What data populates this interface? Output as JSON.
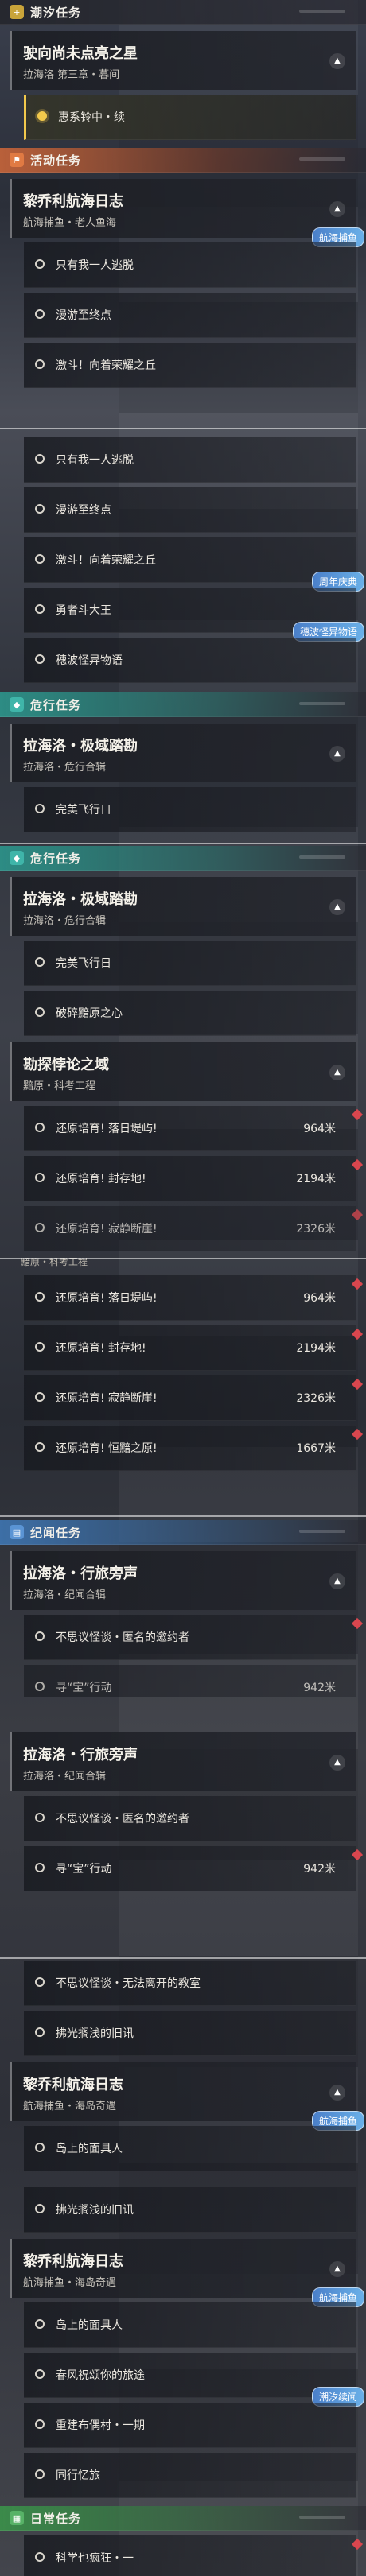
{
  "sections": {
    "s1": {
      "header1": {
        "title": "潮汐任务",
        "icon": "plus-icon"
      },
      "card1": {
        "title": "驶向尚未点亮之星",
        "subtitle": "拉海洛 第三章・暮间"
      },
      "item_active": {
        "label": "惠系铃中・续"
      },
      "header2": {
        "title": "活动任务",
        "icon": "flag-icon"
      },
      "card2": {
        "title": "黎乔利航海日志",
        "subtitle": "航海捕鱼・老人鱼海",
        "badge": "航海捕鱼"
      },
      "items": [
        "只有我一人逃脱",
        "漫游至终点",
        "激斗！向着荣耀之丘"
      ]
    },
    "s2": {
      "items": [
        "只有我一人逃脱",
        "漫游至终点",
        "激斗！向着荣耀之丘",
        "勇者斗大王",
        "穗波怪异物语"
      ],
      "badge_anniv": "周年庆典",
      "badge_story": "穗波怪异物语",
      "header": {
        "title": "危行任务"
      },
      "card": {
        "title": "拉海洛・极域踏勘",
        "subtitle": "拉海洛・危行合辑"
      },
      "item_last": "完美飞行日"
    },
    "s3": {
      "header": {
        "title": "危行任务"
      },
      "card1": {
        "title": "拉海洛・极域踏勘",
        "subtitle": "拉海洛・危行合辑"
      },
      "items1": [
        "完美飞行日",
        "破碎黯原之心"
      ],
      "card2": {
        "title": "勘探悖论之域",
        "subtitle": "黯原・科考工程"
      },
      "items2": [
        {
          "label": "还原培育! 落日堤屿!",
          "dist": "964米"
        },
        {
          "label": "还原培育! 封存地!",
          "dist": "2194米"
        },
        {
          "label": "还原培育! 寂静断崖!",
          "dist": "2326米"
        }
      ]
    },
    "s4": {
      "cut_text": "黯原・科考工程",
      "items": [
        {
          "label": "还原培育! 落日堤屿!",
          "dist": "964米"
        },
        {
          "label": "还原培育! 封存地!",
          "dist": "2194米"
        },
        {
          "label": "还原培育! 寂静断崖!",
          "dist": "2326米"
        },
        {
          "label": "还原培育! 恒黯之原!",
          "dist": "1667米"
        }
      ]
    },
    "s5": {
      "header": {
        "title": "纪闻任务"
      },
      "card": {
        "title": "拉海洛・行旅旁声",
        "subtitle": "拉海洛・纪闻合辑"
      },
      "items": [
        {
          "label": "不思议怪谈・匿名的邀约者",
          "dist": ""
        },
        {
          "label": "寻“宝”行动",
          "dist": "942米"
        }
      ]
    },
    "s6": {
      "card1": {
        "title": "拉海洛・行旅旁声",
        "subtitle": "拉海洛・纪闻合辑"
      },
      "items1": [
        {
          "label": "不思议怪谈・匿名的邀约者",
          "dist": ""
        },
        {
          "label": "寻“宝”行动",
          "dist": "942米"
        },
        {
          "label": "不思议怪谈・无法离开的教室",
          "dist": ""
        },
        {
          "label": "拂光搁浅的旧讯",
          "dist": ""
        }
      ],
      "card2": {
        "title": "黎乔利航海日志",
        "subtitle": "航海捕鱼・海岛奇遇",
        "badge": "航海捕鱼"
      },
      "items2": [
        "岛上的面具人"
      ]
    },
    "s7": {
      "item_top": "拂光搁浅的旧讯",
      "card": {
        "title": "黎乔利航海日志",
        "subtitle": "航海捕鱼・海岛奇遇",
        "badge": "航海捕鱼"
      },
      "items": [
        "岛上的面具人",
        "春风祝颂你的旅途",
        "重建布偶村・一期",
        "同行忆旅"
      ],
      "badge_tide": "潮汐续闻",
      "header": {
        "title": "日常任务"
      },
      "item_last": "科学也疯狂・一"
    }
  },
  "colors": {
    "gold": "#f2c94c",
    "red_marker": "#d9464e",
    "teal": "#2d8c84",
    "orange": "#b9603a",
    "blue": "#3d6fa6",
    "green": "#3b8a4a"
  }
}
